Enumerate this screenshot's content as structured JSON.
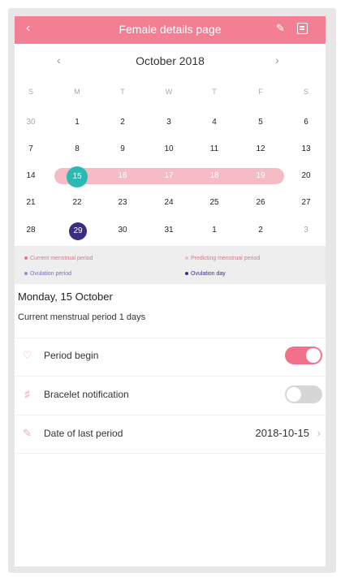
{
  "header": {
    "title": "Female details page",
    "back_icon": "chevron-left-icon",
    "edit_icon": "edit-icon",
    "calendar_icon": "calendar-icon",
    "color": "#f47f94"
  },
  "calendar": {
    "month_label": "October 2018",
    "weekdays": [
      "S",
      "M",
      "T",
      "W",
      "T",
      "F",
      "S"
    ],
    "rows": [
      [
        "30",
        "1",
        "2",
        "3",
        "4",
        "5",
        "6"
      ],
      [
        "7",
        "8",
        "9",
        "10",
        "11",
        "12",
        "13"
      ],
      [
        "14",
        "15",
        "16",
        "17",
        "18",
        "19",
        "20"
      ],
      [
        "21",
        "22",
        "23",
        "24",
        "25",
        "26",
        "27"
      ],
      [
        "28",
        "29",
        "30",
        "31",
        "1",
        "2",
        "3"
      ]
    ],
    "today": "15",
    "range_days": [
      "16",
      "17",
      "18",
      "19"
    ],
    "ovulation_day": "29",
    "colors": {
      "range": "#f5bcc6",
      "today": "#2bb9b1",
      "ovulation": "#3a2d86"
    }
  },
  "legend": {
    "items": [
      {
        "label": "Current menstrual period",
        "color": "#f3708a"
      },
      {
        "label": "Predicting menstrual period",
        "color": "#f5bcc6"
      },
      {
        "label": "Ovulation period",
        "color": "#9c8ac9"
      },
      {
        "label": "Ovulation day",
        "color": "#3a2d86"
      }
    ]
  },
  "summary": {
    "date": "Monday, 15 October",
    "status": "Current menstrual period 1 days"
  },
  "settings": {
    "period_begin": {
      "label": "Period begin",
      "icon": "drop-icon",
      "on": true
    },
    "bracelet": {
      "label": "Bracelet notification",
      "icon": "bell-icon",
      "on": false
    },
    "last_period": {
      "label": "Date of last period",
      "icon": "calendar-edit-icon",
      "value": "2018-10-15"
    }
  }
}
